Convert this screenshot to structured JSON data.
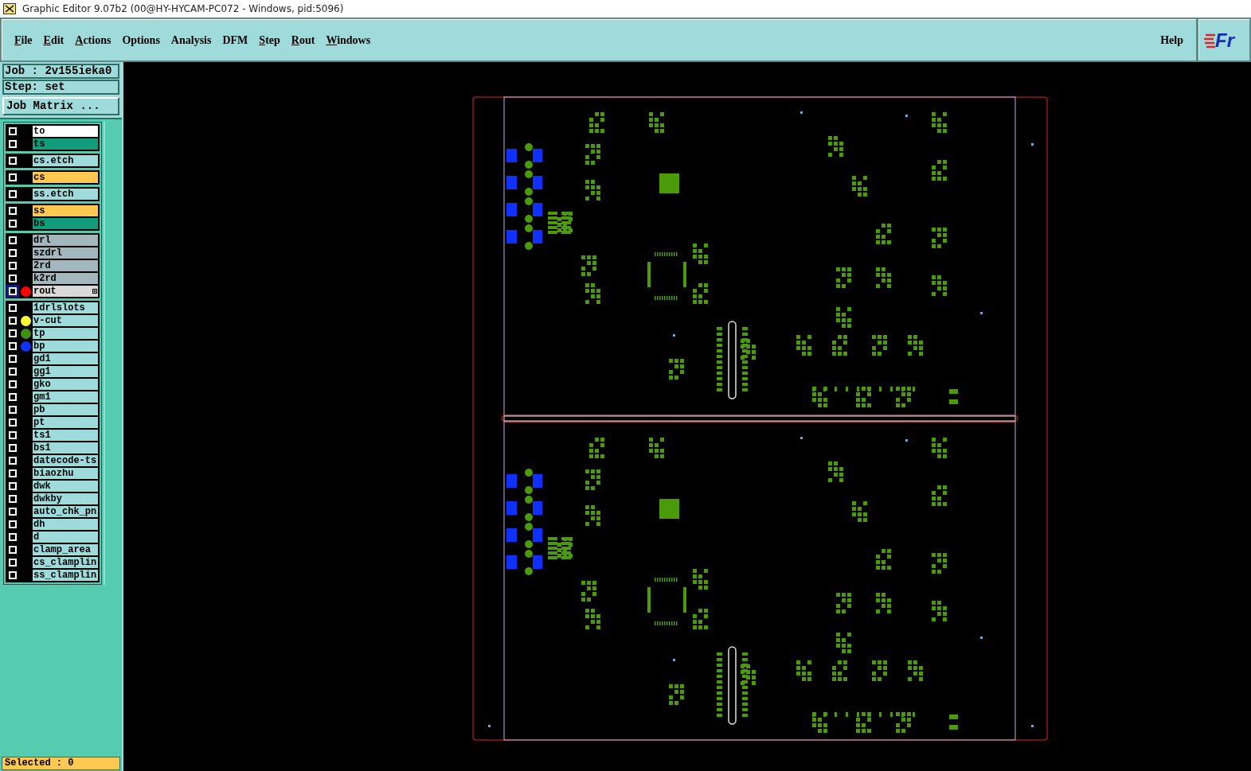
{
  "window": {
    "title": "Graphic Editor 9.07b2 (00@HY-HYCAM-PC072 - Windows, pid:5096)"
  },
  "menu": [
    {
      "label": "File",
      "mnemonic": true
    },
    {
      "label": "Edit",
      "mnemonic": true
    },
    {
      "label": "Actions",
      "mnemonic": true
    },
    {
      "label": "Options",
      "mnemonic": false
    },
    {
      "label": "Analysis",
      "mnemonic": false
    },
    {
      "label": "DFM",
      "mnemonic": false
    },
    {
      "label": "Step",
      "mnemonic": true
    },
    {
      "label": "Rout",
      "mnemonic": true
    },
    {
      "label": "Windows",
      "mnemonic": true
    }
  ],
  "help": "Help",
  "logo_text": "Fr",
  "job": "Job : 2v155ieka0",
  "step": "Step: set",
  "job_matrix_button": "Job Matrix ...",
  "layer_groups": [
    [
      {
        "name": "to",
        "kind": "silk",
        "active": false
      },
      {
        "name": "ts",
        "kind": "mask",
        "active": false
      }
    ],
    [
      {
        "name": "cs.etch",
        "kind": "document",
        "active": false
      }
    ],
    [
      {
        "name": "cs",
        "kind": "signal",
        "active": false
      }
    ],
    [
      {
        "name": "ss.etch",
        "kind": "document",
        "active": false
      }
    ],
    [
      {
        "name": "ss",
        "kind": "signal",
        "active": false
      },
      {
        "name": "bs",
        "kind": "mask",
        "active": false
      }
    ],
    [
      {
        "name": "drl",
        "kind": "drill",
        "active": false
      },
      {
        "name": "szdrl",
        "kind": "drill",
        "active": false
      },
      {
        "name": "2rd",
        "kind": "drill",
        "active": false
      },
      {
        "name": "k2rd",
        "kind": "drill",
        "active": false
      },
      {
        "name": "rout",
        "kind": "rout",
        "active": true,
        "color": "#ff0000"
      }
    ],
    [
      {
        "name": "1drlslots",
        "kind": "document",
        "active": false
      },
      {
        "name": "v-cut",
        "kind": "document",
        "active": false,
        "color": "#ffff33"
      },
      {
        "name": "tp",
        "kind": "document",
        "active": false,
        "color": "#3d8f10"
      },
      {
        "name": "bp",
        "kind": "document",
        "active": false,
        "color": "#1033ff"
      },
      {
        "name": "gd1",
        "kind": "document",
        "active": false
      },
      {
        "name": "gg1",
        "kind": "document",
        "active": false
      },
      {
        "name": "gko",
        "kind": "document",
        "active": false
      },
      {
        "name": "gm1",
        "kind": "document",
        "active": false
      },
      {
        "name": "pb",
        "kind": "document",
        "active": false
      },
      {
        "name": "pt",
        "kind": "document",
        "active": false
      },
      {
        "name": "ts1",
        "kind": "document",
        "active": false
      },
      {
        "name": "bs1",
        "kind": "document",
        "active": false
      },
      {
        "name": "datecode-ts",
        "kind": "document",
        "active": false
      },
      {
        "name": "biaozhu",
        "kind": "document",
        "active": false
      },
      {
        "name": "dwk",
        "kind": "document",
        "active": false
      },
      {
        "name": "dwkby",
        "kind": "document",
        "active": false
      },
      {
        "name": "auto_chk_pn",
        "kind": "document",
        "active": false
      },
      {
        "name": "dh",
        "kind": "document",
        "active": false
      },
      {
        "name": "d",
        "kind": "document",
        "active": false
      },
      {
        "name": "clamp_area",
        "kind": "document",
        "active": false
      },
      {
        "name": "cs_clamplin",
        "kind": "document",
        "active": false
      },
      {
        "name": "ss_clamplin",
        "kind": "document",
        "active": false
      }
    ]
  ],
  "status": "Selected : 0"
}
